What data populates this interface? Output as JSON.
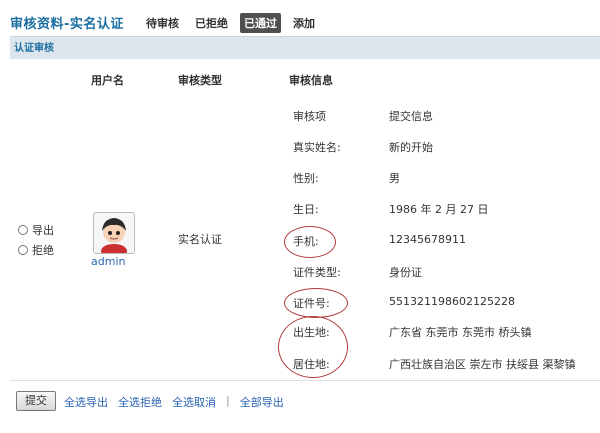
{
  "page": {
    "title": "审核资料-实名认证",
    "tabs": [
      {
        "label": "待审核",
        "active": false
      },
      {
        "label": "已拒绝",
        "active": false
      },
      {
        "label": "已通过",
        "active": true
      },
      {
        "label": "添加",
        "active": false
      }
    ]
  },
  "section": {
    "title": "认证审核"
  },
  "table": {
    "headers": {
      "user": "用户名",
      "type": "审核类型",
      "info": "审核信息"
    },
    "row": {
      "options": [
        "导出",
        "拒绝"
      ],
      "username": "admin",
      "auth_type": "实名认证",
      "info_header": {
        "label": "审核项",
        "value": "提交信息"
      },
      "info_items": [
        {
          "label": "真实姓名:",
          "value": "新的开始"
        },
        {
          "label": "性别:",
          "value": "男"
        },
        {
          "label": "生日:",
          "value": "1986 年  2 月 27 日"
        },
        {
          "label": "手机:",
          "value": "12345678911"
        },
        {
          "label": "证件类型:",
          "value": "身份证"
        },
        {
          "label": "证件号:",
          "value": "551321198602125228"
        },
        {
          "label": "出生地:",
          "value": "广东省 东莞市 东莞市 桥头镇"
        },
        {
          "label": "居住地:",
          "value": "广西壮族自治区 崇左市 扶绥县 渠黎镇"
        }
      ]
    }
  },
  "footer": {
    "submit_label": "提交",
    "actions": [
      "全选导出",
      "全选拒绝",
      "全选取消",
      "全部导出"
    ],
    "separator": "|"
  },
  "colors": {
    "accent": "#1a6ea0",
    "link": "#2a64b0",
    "annotation": "#b23a3a"
  }
}
